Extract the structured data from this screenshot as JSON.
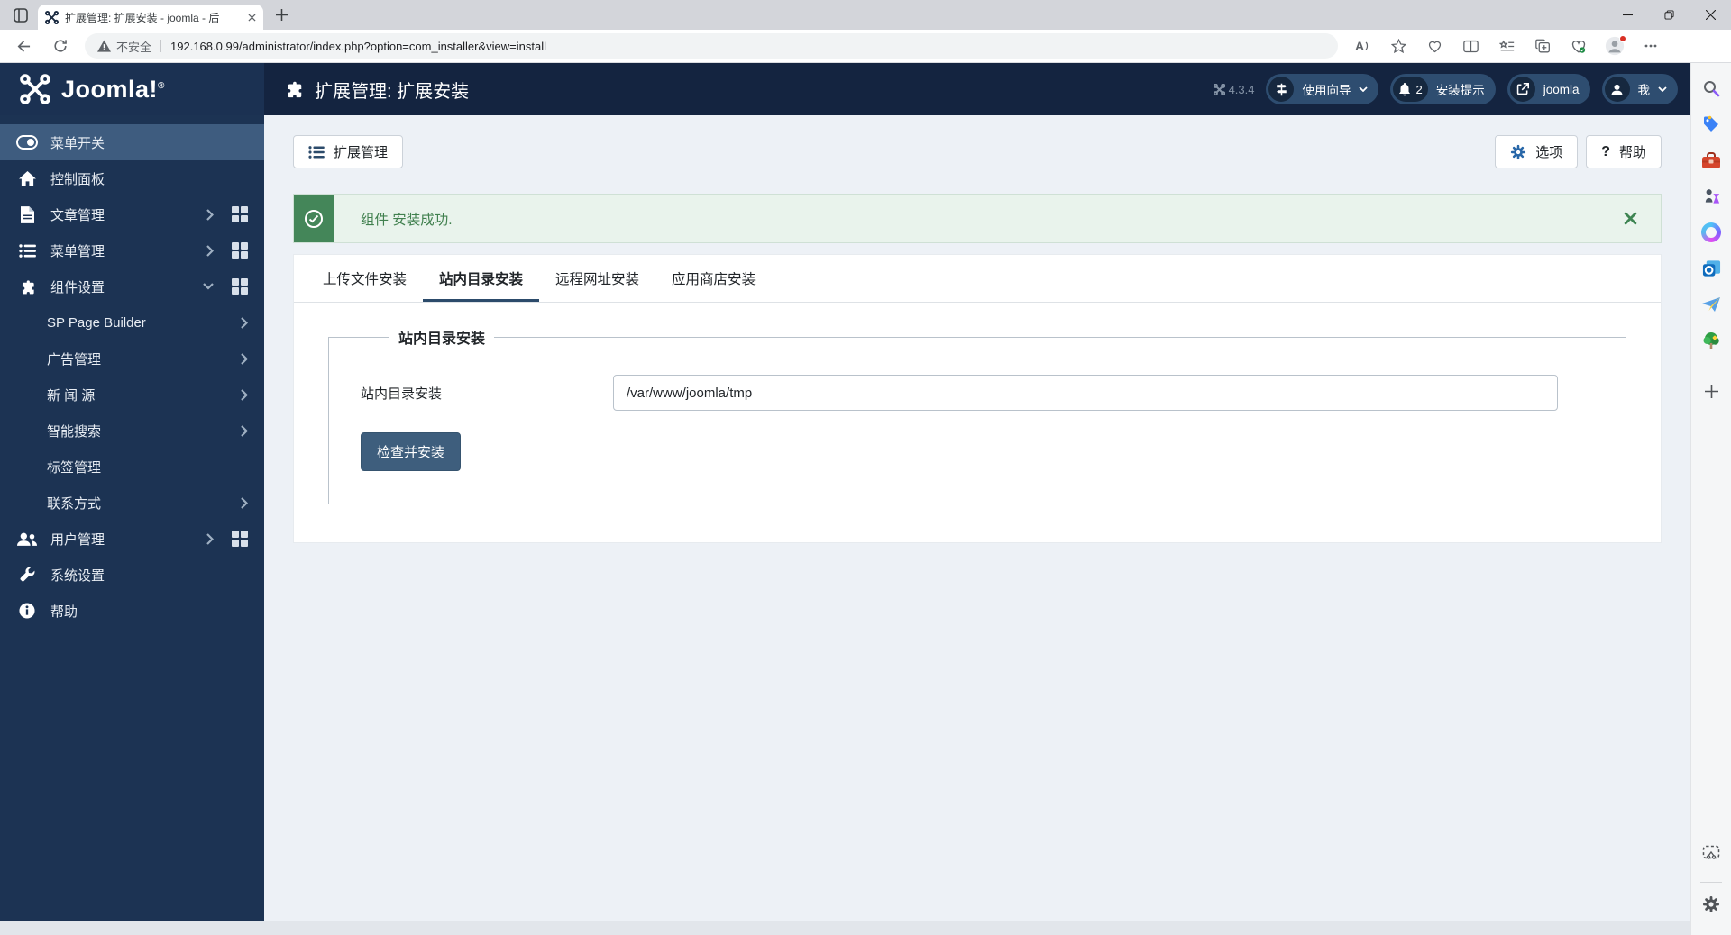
{
  "browser": {
    "tab_title": "扩展管理: 扩展安装 - joomla - 后",
    "security_label": "不安全",
    "url": "192.168.0.99/administrator/index.php?option=com_installer&view=install"
  },
  "icons": {
    "read_aloud": "A",
    "question_mark": "?"
  },
  "app_header": {
    "logo_text": "Joomla!",
    "logo_reg": "®",
    "page_title": "扩展管理: 扩展安装",
    "version": "4.3.4",
    "pills": [
      {
        "label": "使用向导",
        "icon": "signpost-icon",
        "chevron": true
      },
      {
        "label": "安装提示",
        "icon": "bell-icon",
        "badge": "2"
      },
      {
        "label": "joomla",
        "icon": "external-link-icon"
      },
      {
        "label": "我",
        "icon": "user-icon",
        "chevron": true
      }
    ]
  },
  "sidebar": {
    "items": [
      {
        "label": "菜单开关",
        "icon": "toggle-icon",
        "active": true
      },
      {
        "label": "控制面板",
        "icon": "home-icon"
      },
      {
        "label": "文章管理",
        "icon": "article-icon",
        "expandable": true,
        "quick_grid": true
      },
      {
        "label": "菜单管理",
        "icon": "menu-list-icon",
        "expandable": true,
        "quick_grid": true
      },
      {
        "label": "组件设置",
        "icon": "puzzle-icon",
        "expanded": true,
        "quick_grid": true
      },
      {
        "label": "用户管理",
        "icon": "users-icon",
        "expandable": true,
        "quick_grid": true
      },
      {
        "label": "系统设置",
        "icon": "wrench-icon"
      },
      {
        "label": "帮助",
        "icon": "info-icon"
      }
    ],
    "components_submenu": [
      {
        "label": "SP Page Builder",
        "expandable": true
      },
      {
        "label": "广告管理",
        "expandable": true
      },
      {
        "label": "新 闻 源",
        "expandable": true
      },
      {
        "label": "智能搜索",
        "expandable": true
      },
      {
        "label": "标签管理",
        "expandable": false
      },
      {
        "label": "联系方式",
        "expandable": true
      }
    ]
  },
  "main": {
    "toolbar": {
      "manage_label": "扩展管理",
      "options_label": "选项",
      "help_label": "帮助"
    },
    "alert": {
      "message": "组件 安装成功."
    },
    "tabs": [
      {
        "label": "上传文件安装",
        "active": false
      },
      {
        "label": "站内目录安装",
        "active": true
      },
      {
        "label": "远程网址安装",
        "active": false
      },
      {
        "label": "应用商店安装",
        "active": false
      }
    ],
    "form": {
      "legend": "站内目录安装",
      "field_label": "站内目录安装",
      "field_value": "/var/www/joomla/tmp",
      "submit_label": "检查并安装"
    }
  },
  "colors": {
    "header_bg": "#142440",
    "logo_bg": "#1b3152",
    "sidebar_bg": "#1c3353",
    "active_item_bg": "#3e5c7f",
    "accent": "#2c4b6b",
    "success_block": "#448659",
    "alert_bg": "#e9f3ec",
    "primary_button": "#3e5e7d",
    "page_bg": "#edf1f6"
  }
}
